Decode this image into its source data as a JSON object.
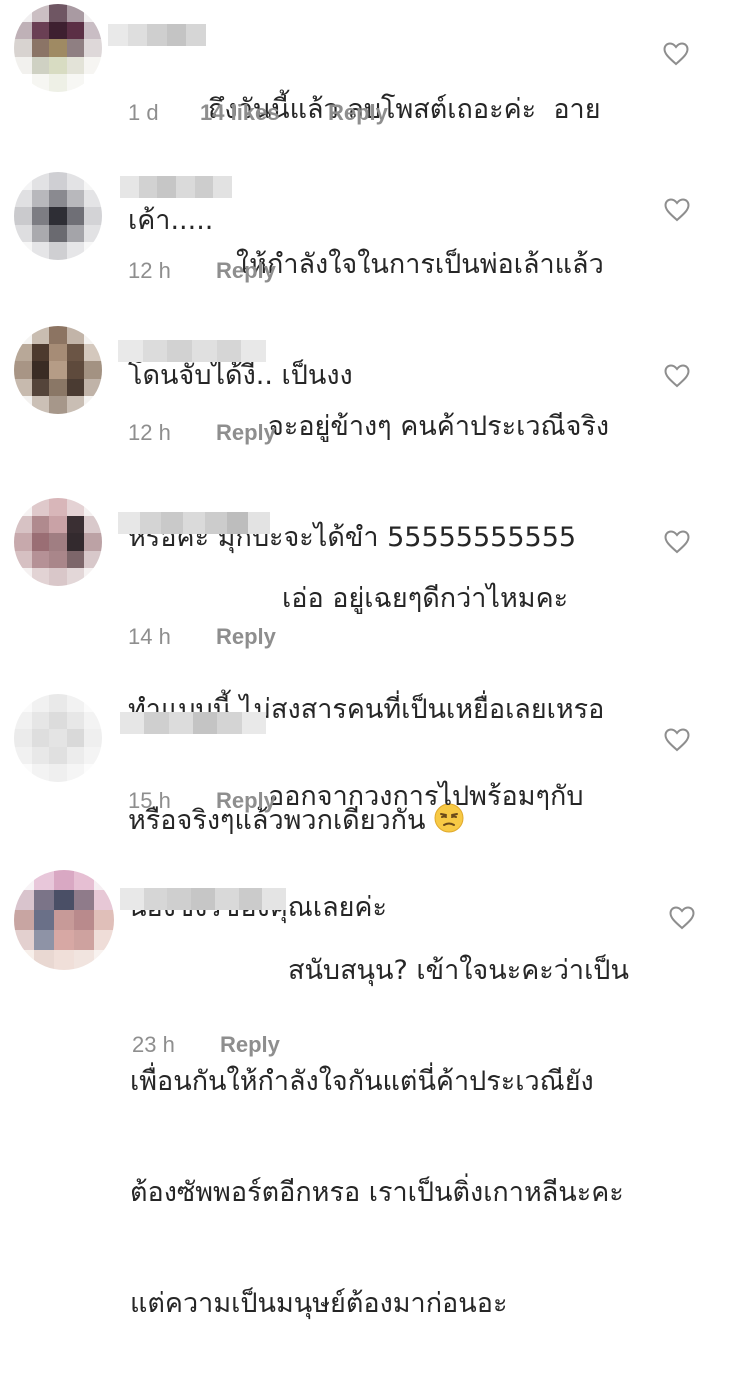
{
  "comments": [
    {
      "lines": [
        "ถึงวันนี้แล้ว ลบโพสต์เถอะค่ะ  อาย",
        "เค้า....."
      ],
      "time": "1 d",
      "likes": "14 likes",
      "reply": "Reply"
    },
    {
      "lines": [
        "ให้กำลังใจในการเป็นพ่อเล้าแล้ว",
        "โดนจับได้งี้.. เป็นงง"
      ],
      "time": "12 h",
      "reply": "Reply"
    },
    {
      "lines": [
        "จะอยู่ข้างๆ คนค้าประเวณีจริง",
        "หรอคะ มุกปะจะได้ขำ 55555555555"
      ],
      "time": "12 h",
      "reply": "Reply"
    },
    {
      "lines": [
        "เอ่อ อยู่เฉยๆดีกว่าไหมคะ",
        "ทำแบบนี้ ไม่สงสารคนที่เป็นเหยื่อเลยเหรอ",
        "หรือจริงๆแล้วพวกเดียวกัน"
      ],
      "time": "14 h",
      "reply": "Reply",
      "emoji": "unamused-face"
    },
    {
      "lines": [
        "ออกจากวงการไปพร้อมๆกับ",
        "น้องซึงรีของคุณเลยค่ะ"
      ],
      "time": "15 h",
      "reply": "Reply"
    },
    {
      "lines": [
        "สนับสนุน? เข้าใจนะคะว่าเป็น",
        "เพื่อนกันให้กำลังใจกันแต่นี่ค้าประเวณียัง",
        "ต้องซัพพอร์ตอีกหรอ เราเป็นติ่งเกาหลีนะคะ",
        "แต่ความเป็นมนุษย์ต้องมาก่อนอะ"
      ],
      "time": "23 h",
      "reply": "Reply"
    }
  ],
  "icons": {
    "like": "heart-outline-icon"
  },
  "colors": {
    "text": "#262626",
    "meta": "#8e8e8e",
    "heart": "#8e8e8e"
  }
}
